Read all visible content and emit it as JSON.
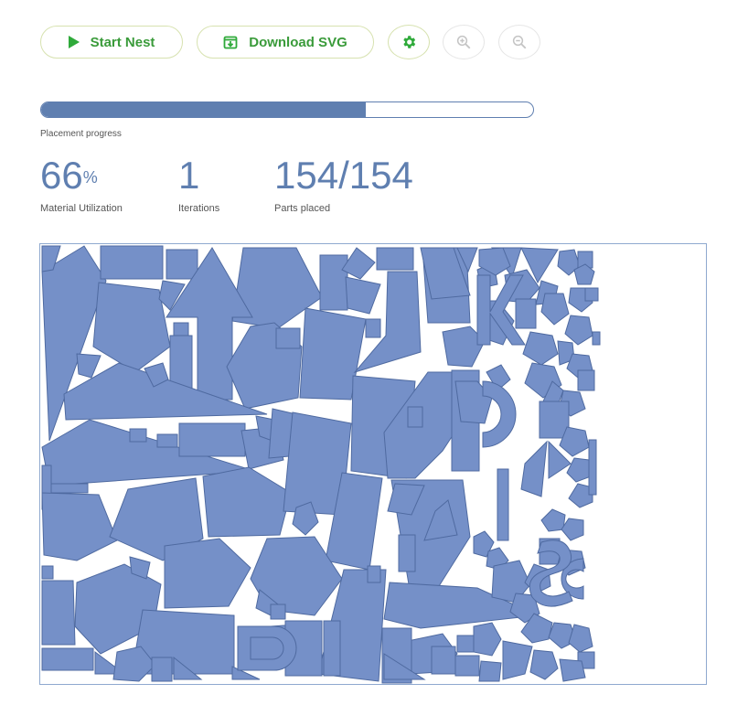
{
  "toolbar": {
    "start_label": "Start Nest",
    "download_label": "Download SVG",
    "icons": {
      "start": "play-icon",
      "download": "download-icon",
      "settings": "gear-icon",
      "zoom_in": "zoom-in-icon",
      "zoom_out": "zoom-out-icon"
    }
  },
  "progress": {
    "label": "Placement progress",
    "fraction": 0.66
  },
  "stats": {
    "utilization_value": "66",
    "utilization_unit": "%",
    "utilization_label": "Material Utilization",
    "iterations_value": "1",
    "iterations_label": "Iterations",
    "parts_value": "154/154",
    "parts_label": "Parts placed"
  },
  "colors": {
    "accent_green": "#3a9b3a",
    "part_fill": "#7590c8",
    "part_stroke": "#4f6aa0",
    "text_blue": "#5f7fb0"
  }
}
